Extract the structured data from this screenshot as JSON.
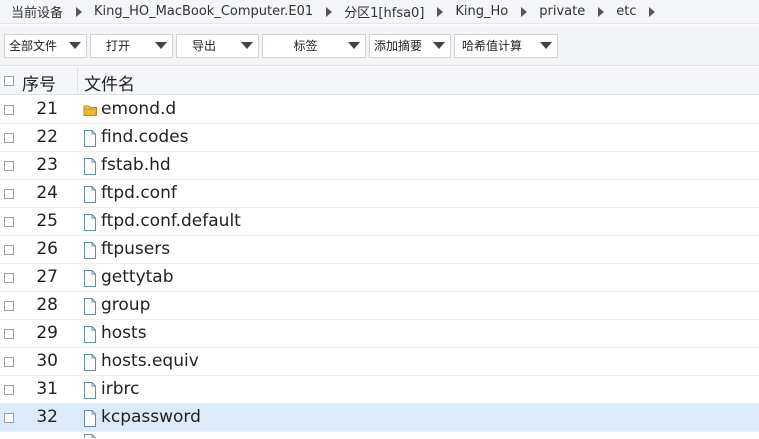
{
  "breadcrumb": {
    "items": [
      {
        "label": "当前设备"
      },
      {
        "label": "King_HO_MacBook_Computer.E01"
      },
      {
        "label": "分区1[hfsa0]"
      },
      {
        "label": "King_Ho"
      },
      {
        "label": "private"
      },
      {
        "label": "etc"
      }
    ]
  },
  "toolbar": {
    "all_files": "全部文件",
    "open": "打开",
    "export": "导出",
    "tags": "标签",
    "add_digest": "添加摘要",
    "hash_calc": "哈希值计算"
  },
  "table": {
    "col_num": "序号",
    "col_name": "文件名",
    "rows": [
      {
        "num": "21",
        "name": "emond.d",
        "type": "folder",
        "selected": false
      },
      {
        "num": "22",
        "name": "find.codes",
        "type": "file",
        "selected": false
      },
      {
        "num": "23",
        "name": "fstab.hd",
        "type": "file",
        "selected": false
      },
      {
        "num": "24",
        "name": "ftpd.conf",
        "type": "file",
        "selected": false
      },
      {
        "num": "25",
        "name": "ftpd.conf.default",
        "type": "file",
        "selected": false
      },
      {
        "num": "26",
        "name": "ftpusers",
        "type": "file",
        "selected": false
      },
      {
        "num": "27",
        "name": "gettytab",
        "type": "file",
        "selected": false
      },
      {
        "num": "28",
        "name": "group",
        "type": "file",
        "selected": false
      },
      {
        "num": "29",
        "name": "hosts",
        "type": "file",
        "selected": false
      },
      {
        "num": "30",
        "name": "hosts.equiv",
        "type": "file",
        "selected": false
      },
      {
        "num": "31",
        "name": "irbrc",
        "type": "file",
        "selected": false
      },
      {
        "num": "32",
        "name": "kcpassword",
        "type": "file",
        "selected": true
      }
    ]
  },
  "colors": {
    "selected_row": "#dcebfb",
    "folder": "#e8b92c",
    "file_icon_stroke": "#6a8bb0"
  }
}
